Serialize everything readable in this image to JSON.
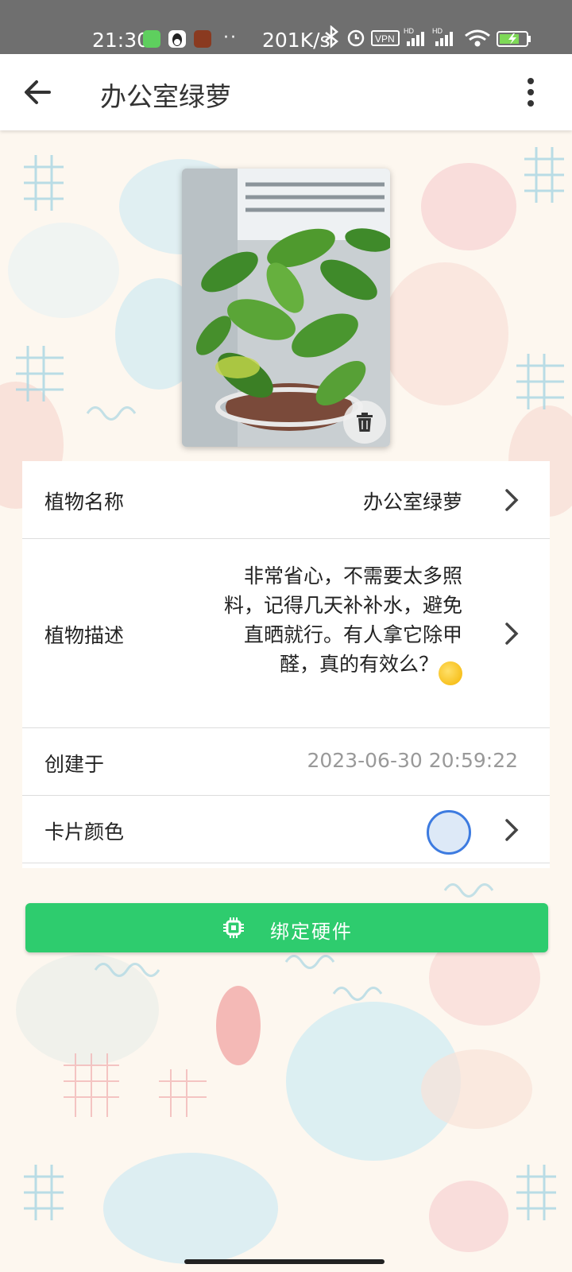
{
  "status_bar": {
    "time": "21:30",
    "dots": "··",
    "network_speed": "201K/s",
    "vpn": "VPN",
    "hd1": "HD",
    "hd2": "HD",
    "icons": [
      "bluetooth-icon",
      "alarm-icon",
      "vpn-icon",
      "signal-icon",
      "wifi-icon",
      "battery-charging-icon"
    ]
  },
  "app_bar": {
    "title": "办公室绿萝",
    "back_icon": "arrow-left-icon",
    "menu_icon": "more-vertical-icon"
  },
  "photo": {
    "subject": "pothos-plant-photo",
    "delete_icon": "trash-icon"
  },
  "details": {
    "name": {
      "label": "植物名称",
      "value": "办公室绿萝"
    },
    "description": {
      "label": "植物描述",
      "value": "非常省心，不需要太多照料，记得几天补补水，避免直晒就行。有人拿它除甲醛，真的有效么？",
      "emoji": "🤔"
    },
    "created": {
      "label": "创建于",
      "value": "2023-06-30 20:59:22"
    },
    "card_color": {
      "label": "卡片颜色",
      "color": "#dde9f7"
    }
  },
  "bind_button": {
    "label": "绑定硬件",
    "icon": "chip-icon"
  },
  "colors": {
    "accent_green": "#2ecc6e",
    "selection_blue": "#3d7be0"
  }
}
